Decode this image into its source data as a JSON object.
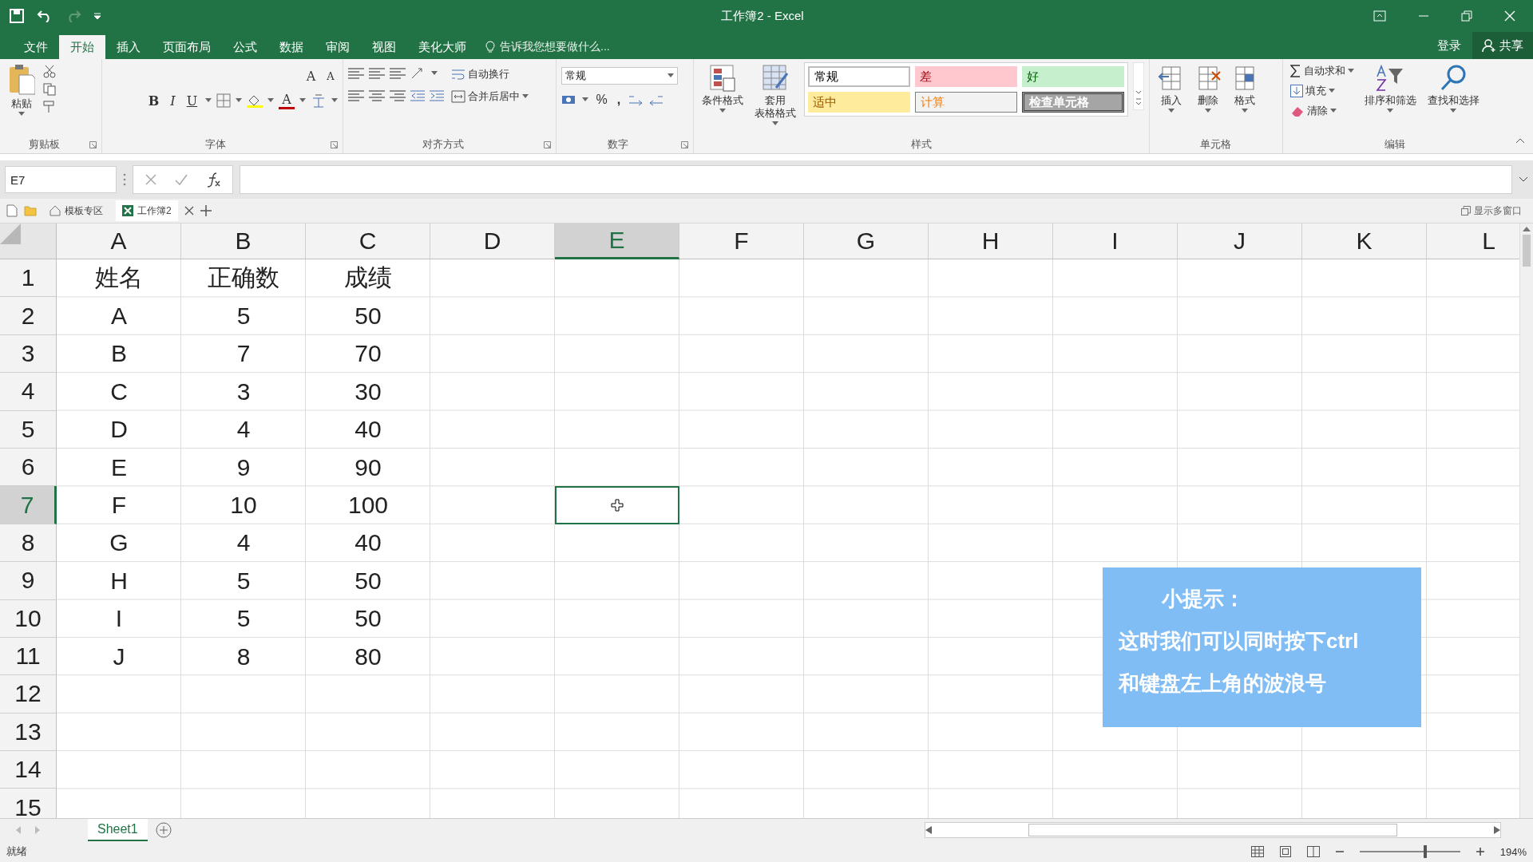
{
  "window": {
    "title": "工作簿2 - Excel"
  },
  "tabs": [
    {
      "label": "文件",
      "selected": false
    },
    {
      "label": "开始",
      "selected": true
    },
    {
      "label": "插入",
      "selected": false
    },
    {
      "label": "页面布局",
      "selected": false
    },
    {
      "label": "公式",
      "selected": false
    },
    {
      "label": "数据",
      "selected": false
    },
    {
      "label": "审阅",
      "selected": false
    },
    {
      "label": "视图",
      "selected": false
    },
    {
      "label": "美化大师",
      "selected": false
    }
  ],
  "tell_me": {
    "placeholder": "告诉我您想要做什么..."
  },
  "account": {
    "sign_in": "登录",
    "share": "共享"
  },
  "ribbon": {
    "clipboard": {
      "label": "剪贴板",
      "paste": "粘贴"
    },
    "font": {
      "label": "字体",
      "grow": "A",
      "shrink": "A",
      "bold": "B",
      "italic": "I",
      "underline": "U",
      "font_color": "A"
    },
    "alignment": {
      "label": "对齐方式",
      "wrap": "自动换行",
      "merge": "合并后居中"
    },
    "number": {
      "label": "数字",
      "format": "常规",
      "percent": "%",
      "comma": ","
    },
    "styles": {
      "label": "样式",
      "conditional": "条件格式",
      "table_format": [
        "套用",
        "表格格式"
      ],
      "cells": [
        {
          "label": "常规",
          "kind": "normal"
        },
        {
          "label": "差",
          "kind": "bad"
        },
        {
          "label": "好",
          "kind": "good"
        },
        {
          "label": "适中",
          "kind": "neutral"
        },
        {
          "label": "计算",
          "kind": "calculation"
        },
        {
          "label": "检查单元格",
          "kind": "check"
        }
      ]
    },
    "cells": {
      "label": "单元格",
      "buttons": [
        "插入",
        "删除",
        "格式"
      ]
    },
    "editing": {
      "label": "编辑",
      "small": [
        "自动求和",
        "填充",
        "清除"
      ],
      "large": [
        "排序和筛选",
        "查找和选择"
      ]
    }
  },
  "formula_bar": {
    "name_box": "E7"
  },
  "file_tabs": {
    "home": "模板专区",
    "workbook": "工作簿2",
    "multi_window": "显示多窗口"
  },
  "columns": [
    {
      "label": "A",
      "selected": false
    },
    {
      "label": "B",
      "selected": false
    },
    {
      "label": "C",
      "selected": false
    },
    {
      "label": "D",
      "selected": false
    },
    {
      "label": "E",
      "selected": true
    },
    {
      "label": "F",
      "selected": false
    },
    {
      "label": "G",
      "selected": false
    },
    {
      "label": "H",
      "selected": false
    },
    {
      "label": "I",
      "selected": false
    },
    {
      "label": "J",
      "selected": false
    },
    {
      "label": "K",
      "selected": false
    },
    {
      "label": "L",
      "selected": false
    }
  ],
  "rows": [
    {
      "label": "1",
      "selected": false,
      "cells": [
        "姓名",
        "正确数",
        "成绩"
      ]
    },
    {
      "label": "2",
      "selected": false,
      "cells": [
        "A",
        "5",
        "50"
      ]
    },
    {
      "label": "3",
      "selected": false,
      "cells": [
        "B",
        "7",
        "70"
      ]
    },
    {
      "label": "4",
      "selected": false,
      "cells": [
        "C",
        "3",
        "30"
      ]
    },
    {
      "label": "5",
      "selected": false,
      "cells": [
        "D",
        "4",
        "40"
      ]
    },
    {
      "label": "6",
      "selected": false,
      "cells": [
        "E",
        "9",
        "90"
      ]
    },
    {
      "label": "7",
      "selected": true,
      "cells": [
        "F",
        "10",
        "100"
      ]
    },
    {
      "label": "8",
      "selected": false,
      "cells": [
        "G",
        "4",
        "40"
      ]
    },
    {
      "label": "9",
      "selected": false,
      "cells": [
        "H",
        "5",
        "50"
      ]
    },
    {
      "label": "10",
      "selected": false,
      "cells": [
        "I",
        "5",
        "50"
      ]
    },
    {
      "label": "11",
      "selected": false,
      "cells": [
        "J",
        "8",
        "80"
      ]
    },
    {
      "label": "12",
      "selected": false
    },
    {
      "label": "13",
      "selected": false
    },
    {
      "label": "14",
      "selected": false
    },
    {
      "label": "15",
      "selected": false
    }
  ],
  "tip": {
    "title": "小提示：",
    "lines": [
      "这时我们可以同时按下ctrl",
      "和键盘左上角的波浪号"
    ]
  },
  "sheets": [
    {
      "label": "Sheet1",
      "selected": true
    }
  ],
  "status_bar": {
    "status": "就绪",
    "zoom": {
      "level": 0.64,
      "reading": "194%"
    }
  }
}
